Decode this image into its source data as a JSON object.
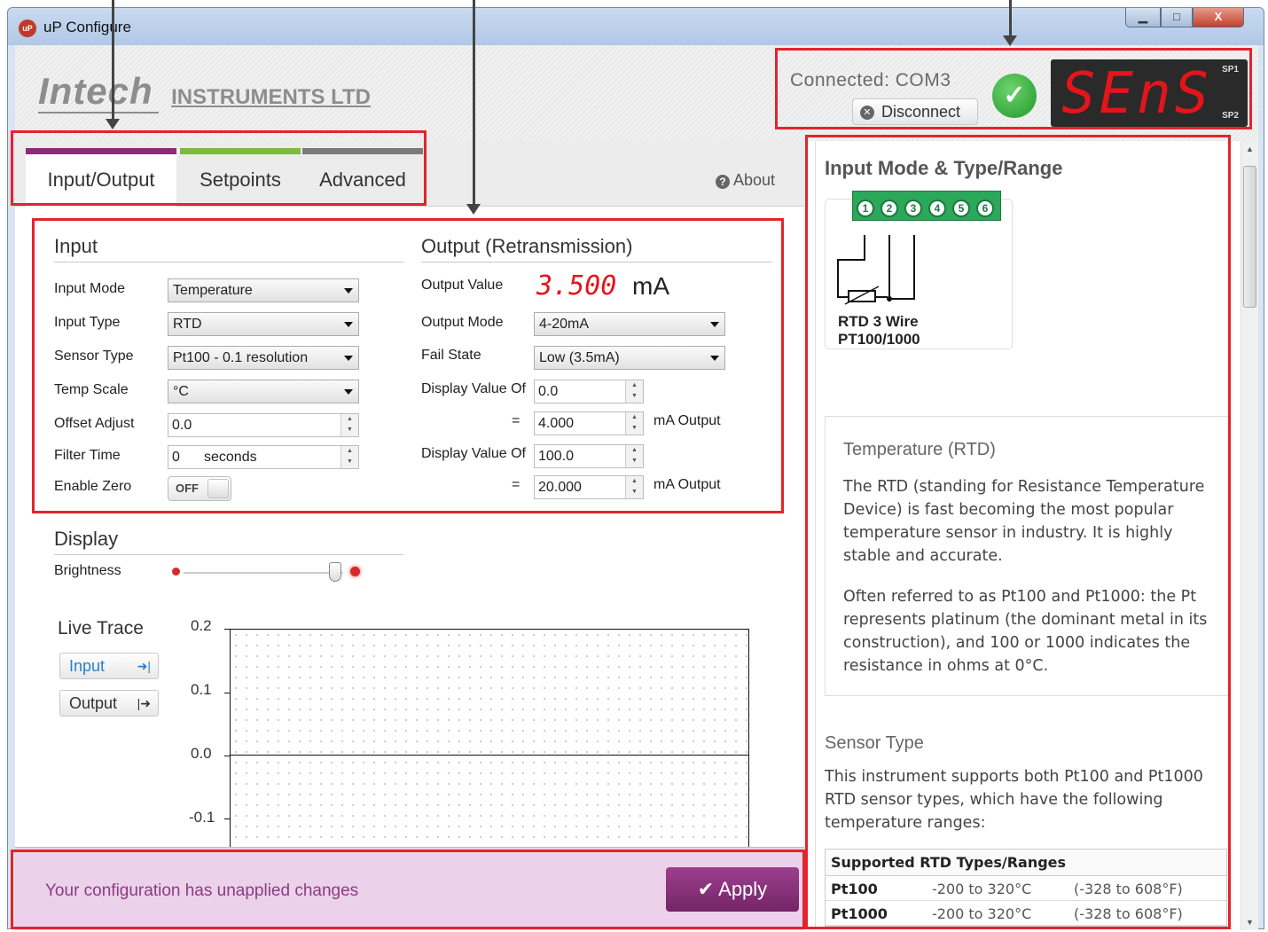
{
  "window": {
    "title": "uP Configure",
    "icon": "uP",
    "min": "▁",
    "max": "□",
    "close": "X"
  },
  "header": {
    "logo_main": "Intech",
    "logo_sub": "INSTRUMENTS LTD",
    "connection": "Connected: COM3",
    "disconnect_label": "Disconnect",
    "display_text": "SEnS",
    "sp1": "SP1",
    "sp2": "SP2"
  },
  "tabs": [
    {
      "label": "Input/Output",
      "color": "#8e2a7a"
    },
    {
      "label": "Setpoints",
      "color": "#7fba3a"
    },
    {
      "label": "Advanced",
      "color": "#7a7a7a"
    }
  ],
  "about_label": "About",
  "input": {
    "title": "Input",
    "fields": [
      {
        "label": "Input Mode",
        "value": "Temperature"
      },
      {
        "label": "Input Type",
        "value": "RTD"
      },
      {
        "label": "Sensor Type",
        "value": "Pt100 - 0.1 resolution"
      },
      {
        "label": "Temp Scale",
        "value": "°C"
      }
    ],
    "offset_label": "Offset Adjust",
    "offset_value": "0.0",
    "filter_label": "Filter Time",
    "filter_value": "0",
    "filter_unit": "seconds",
    "zero_label": "Enable Zero",
    "zero_value": "OFF"
  },
  "output": {
    "title": "Output (Retransmission)",
    "value_label": "Output Value",
    "value": "3.500",
    "value_unit": "mA",
    "mode_label": "Output Mode",
    "mode_value": "4-20mA",
    "fail_label": "Fail State",
    "fail_value": "Low (3.5mA)",
    "dv1_label": "Display Value Of",
    "dv1_value": "0.0",
    "eq1": "=",
    "ma1_value": "4.000",
    "ma_label": "mA Output",
    "dv2_label": "Display Value Of",
    "dv2_value": "100.0",
    "eq2": "=",
    "ma2_value": "20.000"
  },
  "display": {
    "title": "Display",
    "brightness_label": "Brightness",
    "brightness_level": 0.95
  },
  "trace": {
    "title": "Live Trace",
    "input_btn": "Input",
    "output_btn": "Output",
    "y_ticks": [
      "0.2",
      "0.1",
      "0.0",
      "-0.1"
    ]
  },
  "footer": {
    "message": "Your configuration has unapplied changes",
    "apply_label": "Apply"
  },
  "help": {
    "title": "Input Mode & Type/Range",
    "terminals": [
      "1",
      "2",
      "3",
      "4",
      "5",
      "6"
    ],
    "diagram_label_1": "RTD 3 Wire",
    "diagram_label_2": "PT100/1000",
    "info_title": "Temperature (RTD)",
    "info_p1": "The RTD (standing for Resistance Temperature Device) is fast becoming the most popular temperature sensor in industry. It is highly stable and accurate.",
    "info_p2": "Often referred to as Pt100 and Pt1000: the Pt represents platinum (the dominant metal in its construction), and 100 or 1000 indicates the resistance in ohms at 0°C.",
    "sensor_title": "Sensor Type",
    "sensor_p": "This instrument supports both Pt100 and Pt1000 RTD sensor types, which have the following temperature ranges:",
    "table_header": "Supported RTD Types/Ranges",
    "rows": [
      {
        "type": "Pt100",
        "c": "-200 to 320°C",
        "f": "(-328 to 608°F)"
      },
      {
        "type": "Pt1000",
        "c": "-200 to 320°C",
        "f": "(-328 to 608°F)"
      }
    ]
  },
  "colors": {
    "accent": "#8e2a7a",
    "highlight": "#e3242b",
    "led": "#e4141b",
    "ok": "#1f9a2a"
  }
}
